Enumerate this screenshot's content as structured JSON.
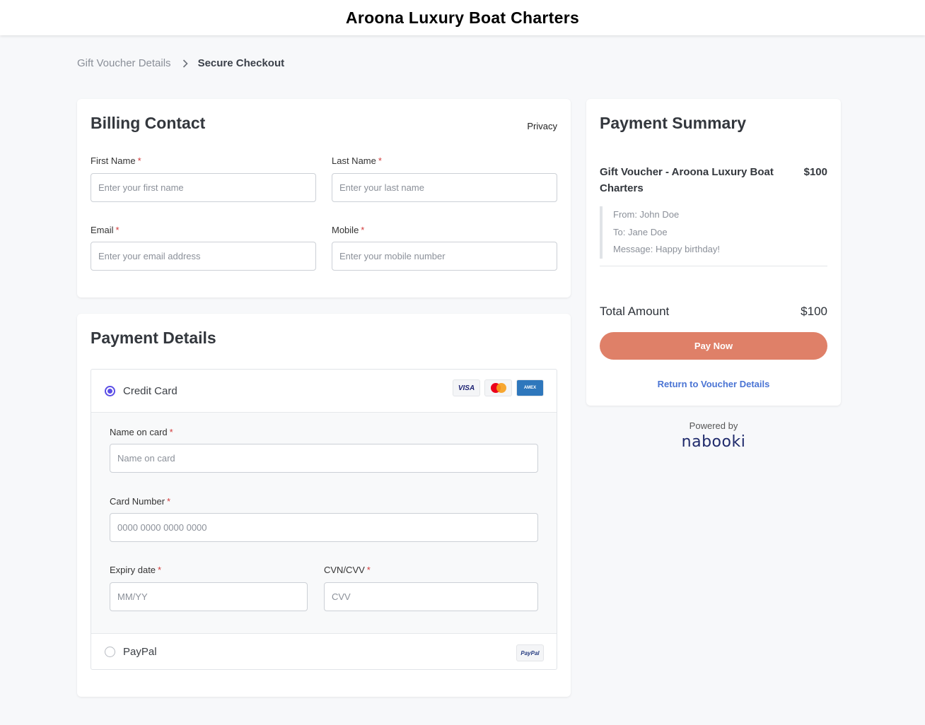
{
  "header": {
    "title": "Aroona Luxury Boat Charters"
  },
  "breadcrumb": {
    "items": [
      "Gift Voucher Details",
      "Secure Checkout"
    ],
    "separator_icon": "chevron-right-icon"
  },
  "billing": {
    "title": "Billing Contact",
    "privacy_link": "Privacy",
    "first_name": {
      "label": "First Name",
      "required": "*",
      "placeholder": "Enter your first name",
      "value": ""
    },
    "last_name": {
      "label": "Last Name",
      "required": "*",
      "placeholder": "Enter your last name",
      "value": ""
    },
    "email": {
      "label": "Email",
      "required": "*",
      "placeholder": "Enter your email address",
      "value": ""
    },
    "mobile": {
      "label": "Mobile",
      "required": "*",
      "placeholder": "Enter your mobile number",
      "value": ""
    }
  },
  "payment": {
    "title": "Payment Details",
    "methods": [
      {
        "label": "Credit Card",
        "selected": true,
        "logos": [
          "visa-icon",
          "mastercard-icon",
          "amex-icon"
        ]
      },
      {
        "label": "PayPal",
        "selected": false,
        "logos": [
          "paypal-icon"
        ]
      }
    ],
    "name_on_card": {
      "label": "Name on card",
      "required": "*",
      "placeholder": "Name on card"
    },
    "card_number": {
      "label": "Card Number",
      "required": "*",
      "placeholder": "0000 0000 0000 0000"
    },
    "expiry": {
      "label": "Expiry date",
      "required": "*",
      "placeholder": "MM/YY"
    },
    "cvv": {
      "label": "CVN/CVV",
      "required": "*",
      "placeholder": "CVV"
    }
  },
  "summary": {
    "title": "Payment Summary",
    "item_name": "Gift Voucher - Aroona Luxury Boat Charters",
    "item_price": "$100",
    "details": {
      "from": "From: John Doe",
      "to": "To: Jane Doe",
      "message": "Message: Happy birthday!"
    },
    "total_label": "Total Amount",
    "total_value": "$100",
    "pay_button": "Pay Now",
    "return_link": "Return to Voucher Details"
  },
  "powered_by": {
    "label": "Powered by",
    "brand": "nabooki"
  },
  "colors": {
    "accent_button": "#df8068",
    "radio_selected": "#5b4ee6",
    "link": "#4a74d4",
    "required": "#d23b3b"
  }
}
